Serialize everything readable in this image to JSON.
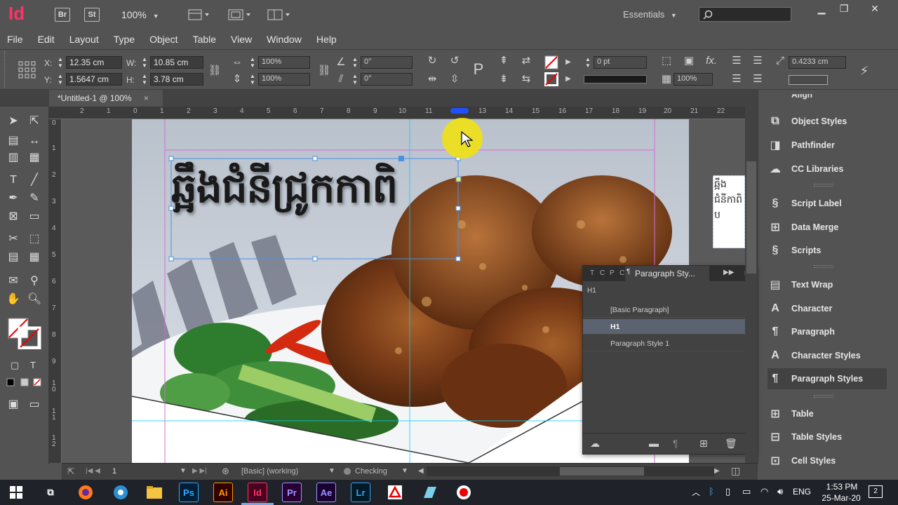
{
  "app": {
    "logo": "Id",
    "bridge_button": "Br",
    "stock_button": "St",
    "zoom": "100%",
    "workspace": "Essentials",
    "search_icon": "search-icon"
  },
  "menu": [
    "File",
    "Edit",
    "Layout",
    "Type",
    "Object",
    "Table",
    "View",
    "Window",
    "Help"
  ],
  "control": {
    "x_label": "X:",
    "x_value": "12.35 cm",
    "y_label": "Y:",
    "y_value": "1.5647 cm",
    "w_label": "W:",
    "w_value": "10.85 cm",
    "h_label": "H:",
    "h_value": "3.78 cm",
    "scale_x": "100%",
    "scale_y": "100%",
    "rotate": "0°",
    "shear": "0°",
    "stroke_weight": "0 pt",
    "opacity": "100%",
    "gap": "0.4233 cm"
  },
  "document": {
    "tab_title": "*Untitled-1 @ 100%",
    "close": "×",
    "headline": "ឆ្អឹងជំនីជ្រូកកាពិ",
    "overset_text": "ឆ្អឹងជំនីកាពិ ប"
  },
  "ruler": {
    "h_ticks": [
      "2",
      "1",
      "0",
      "1",
      "2",
      "3",
      "4",
      "5",
      "6",
      "7",
      "8",
      "9",
      "10",
      "11",
      "12",
      "13",
      "14",
      "15",
      "16",
      "17",
      "18",
      "19",
      "20",
      "21",
      "22"
    ],
    "v_ticks": [
      "0",
      "1",
      "2",
      "3",
      "4",
      "5",
      "6",
      "7",
      "8",
      "9",
      "1\n0",
      "1\n1",
      "1\n2"
    ]
  },
  "dock": [
    {
      "label": "Object Styles",
      "icon": "object-styles-icon"
    },
    {
      "label": "Pathfinder",
      "icon": "pathfinder-icon"
    },
    {
      "label": "CC Libraries",
      "icon": "cc-libraries-icon"
    },
    {
      "label": "Script Label",
      "icon": "script-label-icon"
    },
    {
      "label": "Data Merge",
      "icon": "data-merge-icon"
    },
    {
      "label": "Scripts",
      "icon": "scripts-icon"
    },
    {
      "label": "Text Wrap",
      "icon": "text-wrap-icon"
    },
    {
      "label": "Character",
      "icon": "character-icon"
    },
    {
      "label": "Paragraph",
      "icon": "paragraph-icon"
    },
    {
      "label": "Character Styles",
      "icon": "character-styles-icon"
    },
    {
      "label": "Paragraph Styles",
      "icon": "paragraph-styles-icon"
    },
    {
      "label": "Table",
      "icon": "table-icon"
    },
    {
      "label": "Table Styles",
      "icon": "table-styles-icon"
    },
    {
      "label": "Cell Styles",
      "icon": "cell-styles-icon"
    }
  ],
  "dock_partial": "Align",
  "paragraph_panel": {
    "tabs": [
      "T",
      "C",
      "P",
      "C"
    ],
    "title": "Paragraph Sty...",
    "current_style": "H1",
    "styles": [
      "[Basic Paragraph]",
      "H1",
      "Paragraph Style 1"
    ],
    "selected": "H1"
  },
  "status": {
    "page": "1",
    "preflight_profile": "[Basic] (working)",
    "preflight_state": "Checking"
  },
  "taskbar": {
    "apps": [
      "Ps",
      "Ai",
      "Id",
      "Pr",
      "Ae",
      "Lr"
    ],
    "lang": "ENG",
    "time": "1:53 PM",
    "date": "25-Mar-20",
    "notifications": "2"
  },
  "colors": {
    "indesign": "#ff3366",
    "photoshop": "#31a8ff",
    "illustrator": "#ff9a00",
    "premiere": "#9999ff",
    "aftereffects": "#9999ff",
    "lightroom": "#31a8ff",
    "selection": "#4a90e2",
    "guide": "#00d0ff"
  }
}
